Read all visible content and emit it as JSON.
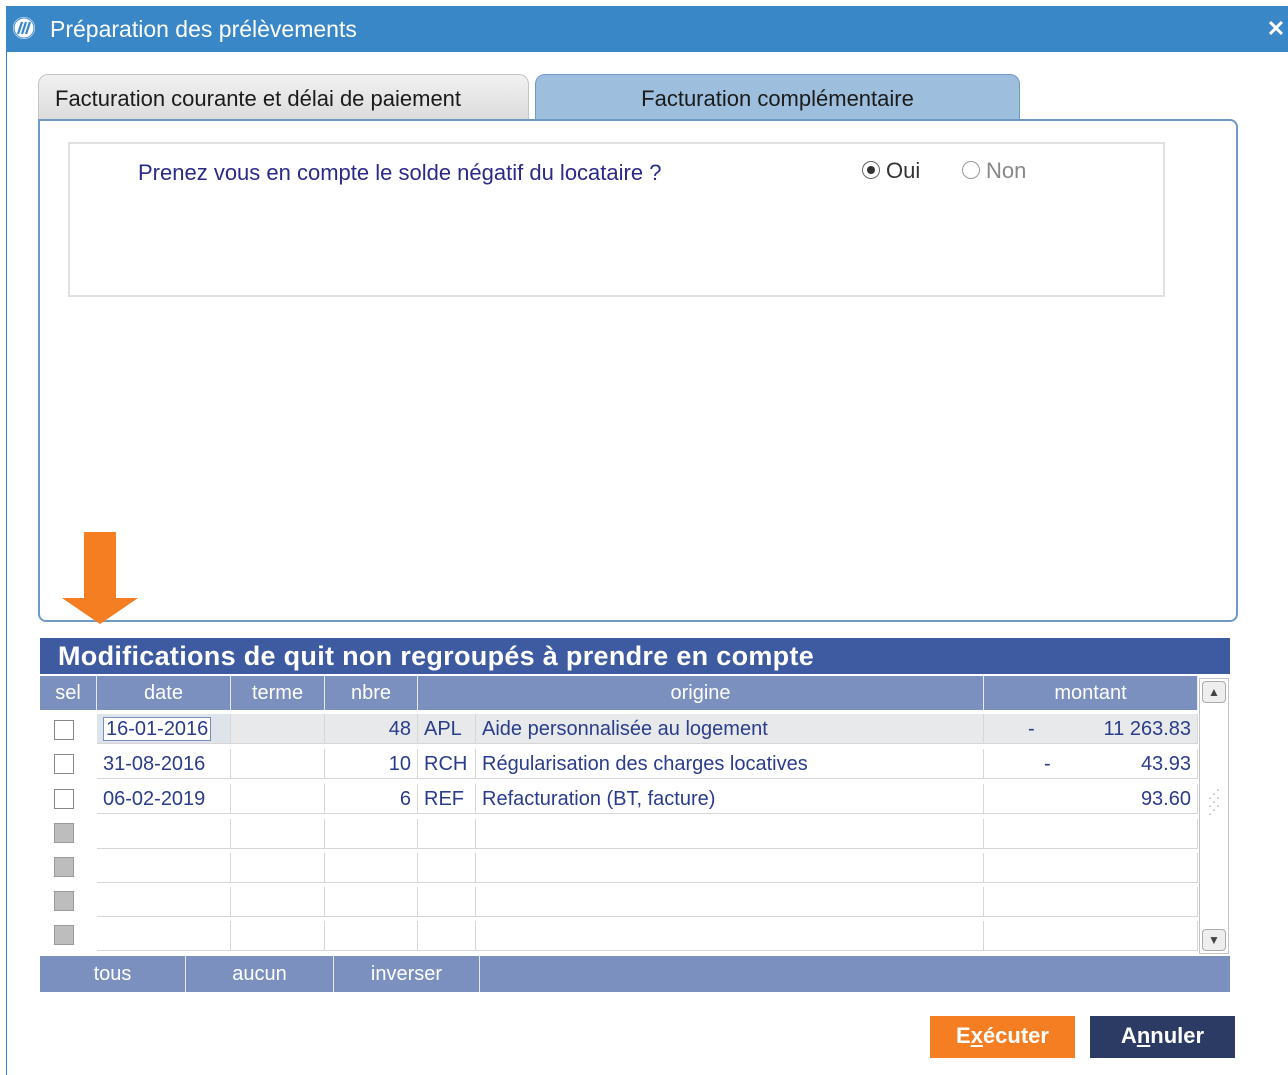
{
  "window": {
    "title": "Préparation des prélèvements",
    "close": "✕"
  },
  "tabs": [
    {
      "label": "Facturation courante et délai de paiement",
      "active": false
    },
    {
      "label": "Facturation complémentaire",
      "active": true
    }
  ],
  "question": {
    "text": "Prenez vous en compte le solde négatif du locataire ?",
    "options": [
      "Oui",
      "Non"
    ],
    "selected": "Oui"
  },
  "grid": {
    "title": "Modifications de quit non regroupés à prendre en compte",
    "columns": [
      "sel",
      "date",
      "terme",
      "nbre",
      "origine",
      "montant"
    ],
    "rows": [
      {
        "checked": false,
        "date": "16-01-2016",
        "terme": "",
        "nbre": "48",
        "code": "APL",
        "origine": "Aide personnalisée au logement",
        "sign": "-",
        "montant": "11 263.83"
      },
      {
        "checked": false,
        "date": "31-08-2016",
        "terme": "",
        "nbre": "10",
        "code": "RCH",
        "origine": "Régularisation des charges locatives",
        "sign": "-",
        "montant": "43.93"
      },
      {
        "checked": false,
        "date": "06-02-2019",
        "terme": "",
        "nbre": "6",
        "code": "REF",
        "origine": "Refacturation (BT, facture)",
        "sign": "",
        "montant": "93.60"
      }
    ],
    "empty_rows": 4,
    "footer": [
      "tous",
      "aucun",
      "inverser"
    ]
  },
  "buttons": {
    "execute": {
      "pre": "E",
      "underlined": "x",
      "post": "écuter"
    },
    "cancel": {
      "pre": "A",
      "underlined": "n",
      "post": "nuler"
    }
  },
  "colors": {
    "titlebar": "#3a87c8",
    "grid_title": "#3e5aa1",
    "grid_header": "#7c90c0",
    "execute": "#f57e22",
    "cancel": "#2b3b64",
    "arrow": "#f57e22"
  },
  "icons": {
    "app": "app-logo-icon",
    "arrow": "down-arrow-icon"
  }
}
